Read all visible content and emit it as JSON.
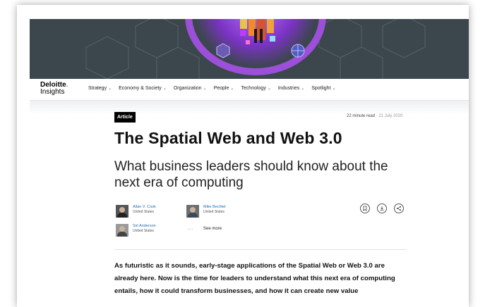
{
  "header": {
    "logo_line1": "Deloitte",
    "logo_dot": ".",
    "logo_line2": "Insights"
  },
  "nav": {
    "items": [
      {
        "label": "Strategy"
      },
      {
        "label": "Economy & Society"
      },
      {
        "label": "Organization"
      },
      {
        "label": "People"
      },
      {
        "label": "Technology"
      },
      {
        "label": "Industries"
      },
      {
        "label": "Spotlight"
      }
    ],
    "chevron": "⌄"
  },
  "article": {
    "tag": "Article",
    "read_time": "22 minute read",
    "date": "21 July 2020",
    "separator": "·",
    "title": "The Spatial Web and Web 3.0",
    "subtitle": "What business leaders should know about the next era of computing",
    "authors": [
      {
        "name": "Allan V. Cook",
        "location": "United States"
      },
      {
        "name": "Mike Bechtel",
        "location": "United States"
      },
      {
        "name": "Siri Anderson",
        "location": "United States"
      }
    ],
    "see_more_dots": "...",
    "see_more": "See more",
    "intro": "As futuristic as it sounds, early-stage applications of the Spatial Web or Web 3.0 are already here. Now is the time for leaders to understand what this next era of computing entails, how it could transform businesses, and how it can create new value"
  },
  "actions": {
    "icons": [
      "bookmark-icon",
      "download-icon",
      "share-icon"
    ]
  },
  "colors": {
    "hero_bg": "#3b464d",
    "accent_purple": "#9c4fd8",
    "link_blue": "#1f6fb2",
    "brand_green": "#86bc25"
  }
}
